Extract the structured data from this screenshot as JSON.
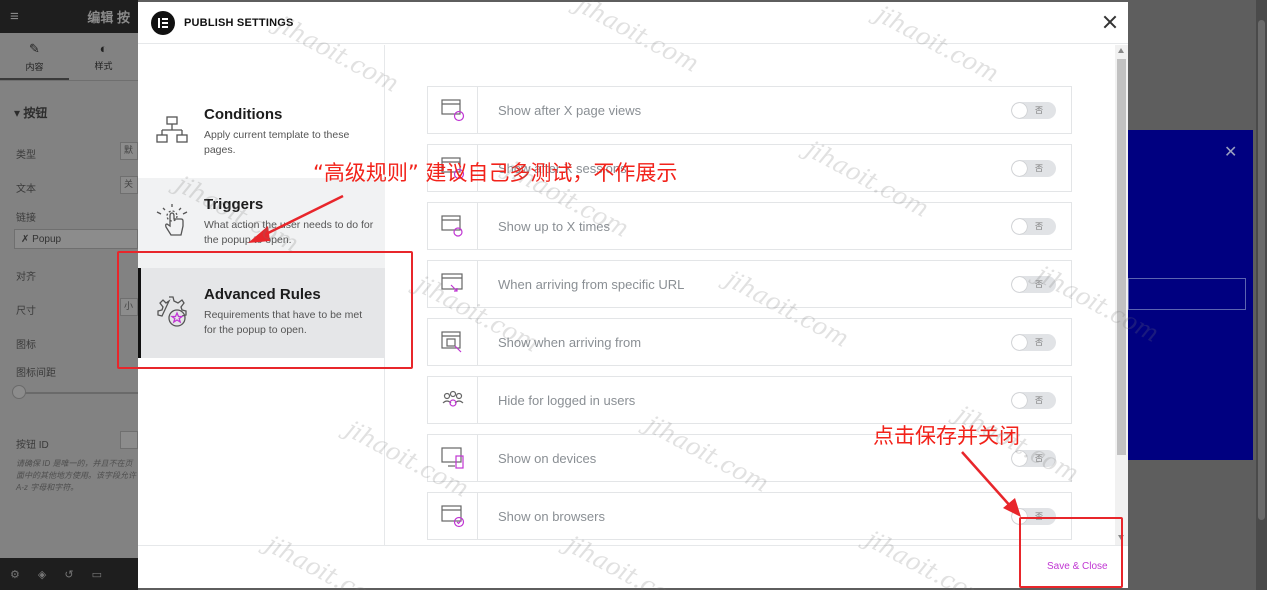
{
  "background": {
    "panel_title": "编辑 按",
    "tabs": [
      {
        "label": "内容",
        "icon": "pencil-icon"
      },
      {
        "label": "样式",
        "icon": "half-circle-icon"
      }
    ],
    "section": "▾ 按钮",
    "rows": [
      {
        "label": "类型",
        "value": "默"
      },
      {
        "label": "文本",
        "value": "关"
      },
      {
        "label": "链接",
        "value": ""
      },
      {
        "label": "对齐",
        "value": ""
      },
      {
        "label": "尺寸",
        "value": "小"
      },
      {
        "label": "图标",
        "value": ""
      },
      {
        "label": "图标间距",
        "value": ""
      },
      {
        "label": "按钮 ID",
        "value": ""
      }
    ],
    "link_value": "Popup",
    "help_text": "请确保 ID 是唯一的，并且不在页面中的其他地方使用。该字段允许 A-z 字母和字符。"
  },
  "modal": {
    "title": "PUBLISH SETTINGS",
    "save_label": "Save & Close",
    "nav": [
      {
        "title": "Conditions",
        "desc": "Apply current template to these pages."
      },
      {
        "title": "Triggers",
        "desc": "What action the user needs to do for the popup to open."
      },
      {
        "title": "Advanced Rules",
        "desc": "Requirements that have to be met for the popup to open."
      }
    ],
    "rules": [
      {
        "label": "Show after X page views",
        "toggle": "否"
      },
      {
        "label": "Show after X sessions",
        "toggle": "否"
      },
      {
        "label": "Show up to X times",
        "toggle": "否"
      },
      {
        "label": "When arriving from specific URL",
        "toggle": "否"
      },
      {
        "label": "Show when arriving from",
        "toggle": "否"
      },
      {
        "label": "Hide for logged in users",
        "toggle": "否"
      },
      {
        "label": "Show on devices",
        "toggle": "否"
      },
      {
        "label": "Show on browsers",
        "toggle": "否"
      }
    ]
  },
  "annotations": {
    "advanced_note": "“高级规则”  建议自己多测试，不作展示",
    "save_note": "点击保存并关闭"
  },
  "watermark": "jihaoit.com",
  "colors": {
    "accent": "#c036d3",
    "annotation": "#e8262b",
    "active_nav": "#e5e6e8"
  }
}
